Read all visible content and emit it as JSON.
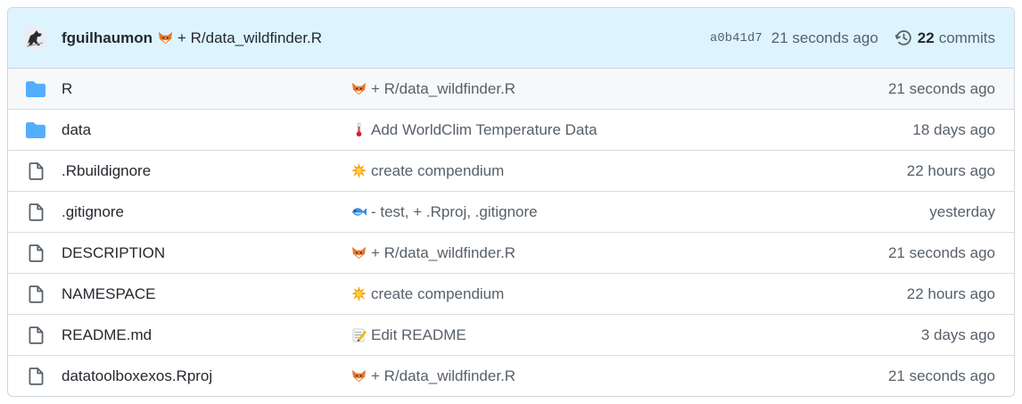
{
  "header": {
    "author": "fguilhaumon",
    "message_emoji": "fox-emoji",
    "message": "+ R/data_wildfinder.R",
    "sha": "a0b41d7",
    "time": "21 seconds ago",
    "commit_count": "22",
    "commits_label": "commits"
  },
  "files": [
    {
      "type": "folder",
      "name": "R",
      "emoji": "fox-emoji",
      "message": "+ R/data_wildfinder.R",
      "time": "21 seconds ago"
    },
    {
      "type": "folder",
      "name": "data",
      "emoji": "thermometer-emoji",
      "message": "Add WorldClim Temperature Data",
      "time": "18 days ago"
    },
    {
      "type": "file",
      "name": ".Rbuildignore",
      "emoji": "collision-emoji",
      "message": "create compendium",
      "time": "22 hours ago"
    },
    {
      "type": "file",
      "name": ".gitignore",
      "emoji": "fish-emoji",
      "message": "- test, + .Rproj, .gitignore",
      "time": "yesterday"
    },
    {
      "type": "file",
      "name": "DESCRIPTION",
      "emoji": "fox-emoji",
      "message": "+ R/data_wildfinder.R",
      "time": "21 seconds ago"
    },
    {
      "type": "file",
      "name": "NAMESPACE",
      "emoji": "collision-emoji",
      "message": "create compendium",
      "time": "22 hours ago"
    },
    {
      "type": "file",
      "name": "README.md",
      "emoji": "memo-emoji",
      "message": "Edit README",
      "time": "3 days ago"
    },
    {
      "type": "file",
      "name": "datatoolboxexos.Rproj",
      "emoji": "fox-emoji",
      "message": "+ R/data_wildfinder.R",
      "time": "21 seconds ago"
    }
  ],
  "colors": {
    "header_bg": "#ddf4ff",
    "folder": "#54aeff",
    "file_icon": "#57606a",
    "border": "#d0d7de"
  }
}
